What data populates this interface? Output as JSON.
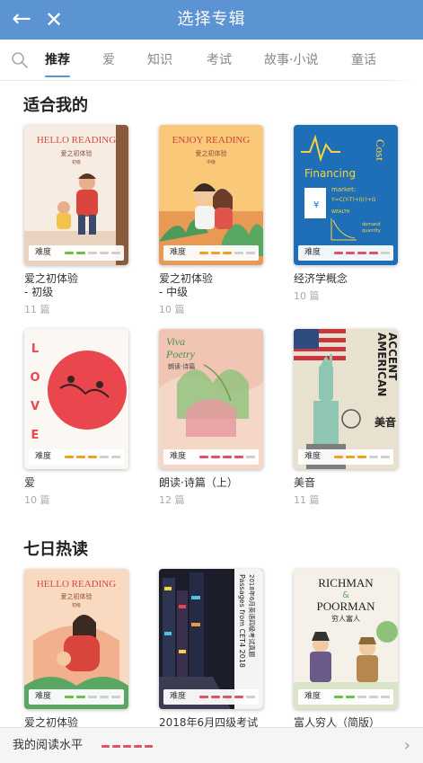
{
  "header": {
    "title": "选择专辑",
    "back_icon": "←",
    "close_icon": "✕",
    "bg": "#5b93d3"
  },
  "tabs": [
    {
      "label": "推荐",
      "active": true
    },
    {
      "label": "爱"
    },
    {
      "label": "知识"
    },
    {
      "label": "考试"
    },
    {
      "label": "故事·小说"
    },
    {
      "label": "童话"
    }
  ],
  "sections": [
    {
      "title": "适合我的",
      "books": [
        {
          "name": "爱之初体验\n- 初级",
          "count": "11 篇",
          "difficulty_label": "难度",
          "level": 2,
          "level_color": "#6cc04a",
          "cover": "reading-red",
          "cover_text": [
            "HELLO READING",
            "爱之初体验",
            "初级"
          ]
        },
        {
          "name": "爱之初体验\n- 中级",
          "count": "10 篇",
          "difficulty_label": "难度",
          "level": 3,
          "level_color": "#f0a023",
          "cover": "reading-orange",
          "cover_text": [
            "ENJOY READING",
            "爱之初体验",
            "中级"
          ]
        },
        {
          "name": "经济学概念",
          "count": "10 篇",
          "difficulty_label": "难度",
          "level": 4,
          "level_color": "#e05362",
          "cover": "economics",
          "cover_text": [
            "Financing",
            "Cost",
            "market:",
            "Y=C(Y-T)+I(r)+G",
            "WEALTH",
            "demand",
            "quantity"
          ]
        },
        {
          "name": "爱",
          "count": "10 篇",
          "difficulty_label": "难度",
          "level": 3,
          "level_color": "#f0a023",
          "cover": "love",
          "cover_text": [
            "L",
            "O",
            "V",
            "E"
          ]
        },
        {
          "name": "朗读·诗篇（上）",
          "count": "12 篇",
          "difficulty_label": "难度",
          "level": 4,
          "level_color": "#e05362",
          "cover": "poetry",
          "cover_text": [
            "Viva",
            "Poetry",
            "朗读·诗篇"
          ]
        },
        {
          "name": "美音",
          "count": "11 篇",
          "difficulty_label": "难度",
          "level": 3,
          "level_color": "#f0a023",
          "cover": "american",
          "cover_text": [
            "AMERICAN",
            "ACCENT",
            "美音"
          ]
        }
      ]
    },
    {
      "title": "七日热读",
      "books": [
        {
          "name": "爱之初体验",
          "count": "",
          "difficulty_label": "难度",
          "level": 2,
          "level_color": "#6cc04a",
          "cover": "reading-red2",
          "cover_text": [
            "HELLO READING",
            "爱之初体验",
            "初级"
          ]
        },
        {
          "name": "2018年6月四级考试",
          "count": "",
          "difficulty_label": "难度",
          "level": 4,
          "level_color": "#e05362",
          "cover": "cet4",
          "cover_text": [
            "Passages from CET4 2018",
            "2018年6月英语四级考试真题"
          ]
        },
        {
          "name": "富人穷人（简版）",
          "count": "",
          "difficulty_label": "难度",
          "level": 2,
          "level_color": "#6cc04a",
          "cover": "richman",
          "cover_text": [
            "RICHMAN",
            "&",
            "POORMAN",
            "穷人富人"
          ]
        }
      ]
    }
  ],
  "bottom": {
    "label": "我的阅读水平",
    "level": 5,
    "level_color": "#e05362",
    "arrow_icon": "›"
  }
}
